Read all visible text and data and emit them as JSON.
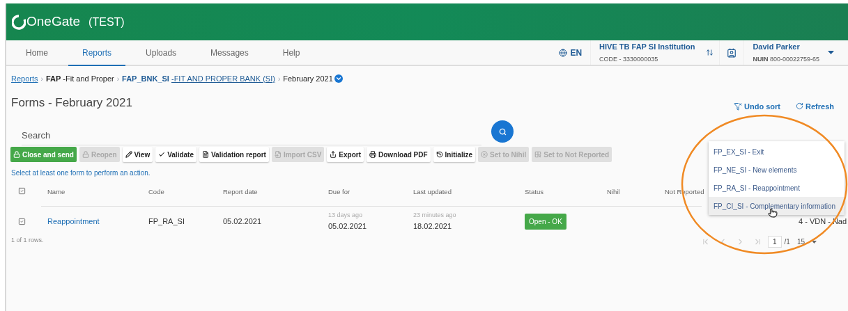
{
  "header": {
    "logo": "OneGate",
    "environment": "(TEST)"
  },
  "nav": {
    "tabs": [
      {
        "label": "Home",
        "selected": false
      },
      {
        "label": "Reports",
        "selected": true
      },
      {
        "label": "Uploads",
        "selected": false
      },
      {
        "label": "Messages",
        "selected": false
      },
      {
        "label": "Help",
        "selected": false
      }
    ],
    "language": "EN",
    "institution": {
      "name": "HIVE TB FAP SI Institution",
      "code": "CODE - 3330000035"
    },
    "user": {
      "name": "David Parker",
      "id_label": "NUIN",
      "id": "800-00022759-65"
    }
  },
  "breadcrumb_separator": "›",
  "breadcrumb": [
    {
      "kind": "link",
      "text": "Reports"
    },
    {
      "kind": "code",
      "code": "FAP",
      "text": "-Fit and Proper"
    },
    {
      "kind": "code_link",
      "code": "FAP_BNK_SI",
      "text": "-FIT AND PROPER BANK (SI)"
    },
    {
      "kind": "current",
      "text": "February 2021"
    }
  ],
  "page_title": "Forms - February 2021",
  "actions": [
    "Undo sort",
    "Refresh"
  ],
  "search": {
    "placeholder": "Search"
  },
  "toolbar": [
    {
      "label": "Close and send",
      "kind": "primary",
      "disabled": false
    },
    {
      "label": "Reopen",
      "kind": "default",
      "disabled": true
    },
    {
      "label": "View",
      "kind": "default",
      "disabled": false
    },
    {
      "label": "Validate",
      "kind": "default",
      "disabled": false
    },
    {
      "label": "Validation report",
      "kind": "default",
      "disabled": false
    },
    {
      "label": "Import CSV",
      "kind": "default",
      "disabled": true
    },
    {
      "label": "Export",
      "kind": "default",
      "disabled": false
    },
    {
      "label": "Download PDF",
      "kind": "default",
      "disabled": false
    },
    {
      "label": "Initialize",
      "kind": "default",
      "disabled": false
    },
    {
      "label": "Set to Nihil",
      "kind": "default",
      "disabled": true
    },
    {
      "label": "Set to Not Reported",
      "kind": "default",
      "disabled": true
    }
  ],
  "hint": "Select at least one form to perform an action.",
  "table": {
    "select_all_checked": false,
    "columns": [
      "Name",
      "Code",
      "Report date",
      "Due for",
      "Last updated",
      "Status",
      "Nihil",
      "Not Reported"
    ],
    "rows": [
      {
        "checked": false,
        "name": "Reappointment",
        "code": "FP_RA_SI",
        "report_date": "05.02.2021",
        "due_for": {
          "relative": "13 days ago",
          "date": "05.02.2021"
        },
        "last_updated": {
          "relative": "23 minutes ago",
          "date": "18.02.2021"
        },
        "status": "Open - OK",
        "column_9": "4 - VDN - Nad"
      }
    ]
  },
  "row_count": "1 of 1 rows.",
  "pagination": {
    "page": "1",
    "total": "/1",
    "page_size": "15"
  },
  "dropdown": [
    {
      "label": "FP_EX_SI - Exit",
      "selected": false
    },
    {
      "label": "FP_NE_SI - New elements",
      "selected": false
    },
    {
      "label": "FP_RA_SI - Reappointment",
      "selected": false
    },
    {
      "label": "FP_CI_SI - Complementary information",
      "selected": true
    }
  ]
}
